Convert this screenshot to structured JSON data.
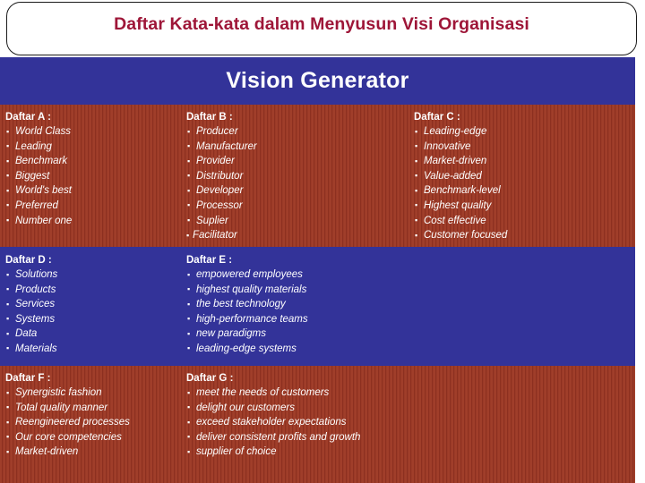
{
  "slide": {
    "title": "Daftar Kata-kata dalam Menyusun Visi Organisasi",
    "banner": "Vision Generator",
    "title_color": "#9e1638",
    "banner_color": "#333399",
    "brick_color": "#9b3a27"
  },
  "lists": [
    {
      "id": "a",
      "heading": "Daftar A :",
      "items": [
        "World Class",
        "Leading",
        "Benchmark",
        "Biggest",
        "World's best",
        "Preferred",
        "Number one"
      ]
    },
    {
      "id": "b",
      "heading": "Daftar B :",
      "items": [
        "Producer",
        "Manufacturer",
        "Provider",
        "Distributor",
        "Developer",
        "Processor",
        "Suplier",
        "Facilitator"
      ]
    },
    {
      "id": "c",
      "heading": "Daftar C :",
      "items": [
        "Leading-edge",
        "Innovative",
        "Market-driven",
        "Value-added",
        "Benchmark-level",
        "Highest quality",
        "Cost effective",
        "Customer focused"
      ]
    },
    {
      "id": "d",
      "heading": "Daftar D :",
      "items": [
        "Solutions",
        "Products",
        "Services",
        "Systems",
        "Data",
        "Materials"
      ]
    },
    {
      "id": "e",
      "heading": "Daftar E :",
      "items": [
        "empowered employees",
        "highest quality materials",
        "the best technology",
        "high-performance teams",
        "new paradigms",
        "leading-edge systems"
      ]
    },
    {
      "id": "f",
      "heading": "Daftar F :",
      "items": [
        "Synergistic fashion",
        "Total quality manner",
        "Reengineered processes",
        "Our core competencies",
        "Market-driven"
      ]
    },
    {
      "id": "g",
      "heading": "Daftar G :",
      "items": [
        "meet the needs of customers",
        "delight our customers",
        "exceed stakeholder expectations",
        "deliver consistent profits and growth",
        "supplier of choice"
      ]
    }
  ]
}
